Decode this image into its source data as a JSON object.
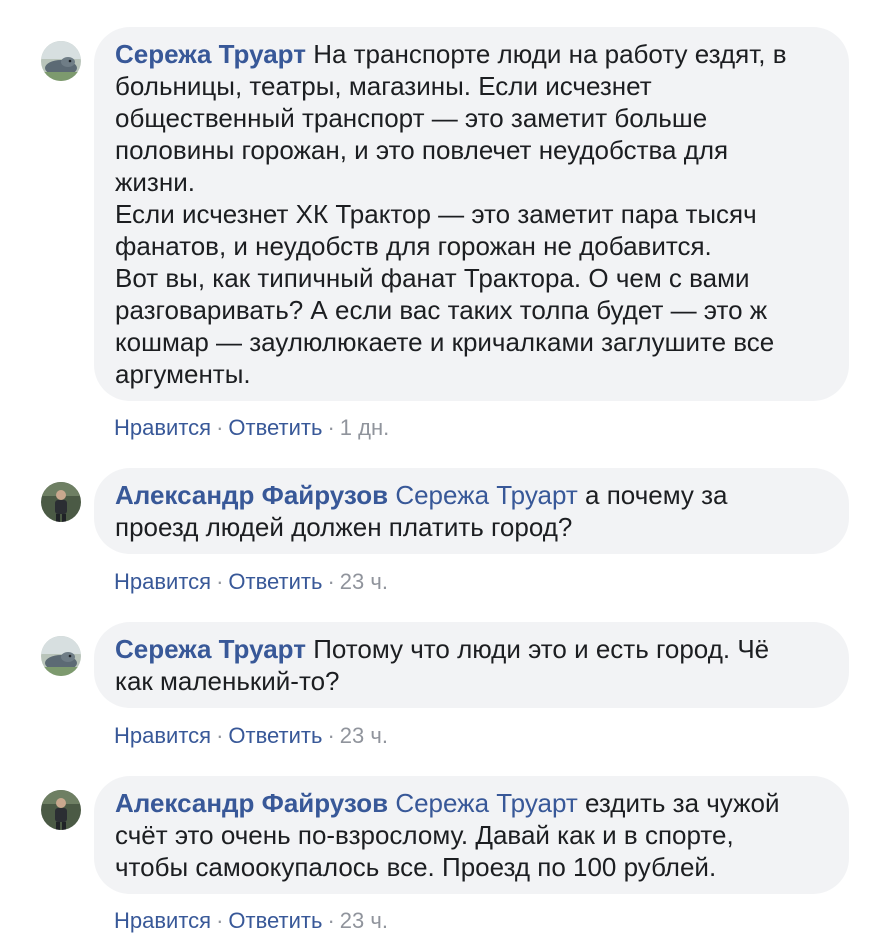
{
  "comments": [
    {
      "author": "Сережа Труарт",
      "mention": "",
      "lines": [
        "На транспорте люди на работу ездят, в",
        "больницы, театры, магазины. Если исчезнет",
        "общественный транспорт — это заметит больше",
        "половины горожан, и это повлечет неудобства для",
        "жизни.",
        "Если исчезнет ХК Трактор — это заметит пара тысяч",
        "фанатов, и неудобств для горожан не добавится.",
        "Вот вы, как типичный фанат Трактора. О чем с вами",
        "разговаривать? А если вас таких толпа будет — это ж",
        "кошмар — заулюлюкаете и кричалками заглушите все",
        "аргументы."
      ],
      "like_label": "Нравится",
      "reply_label": "Ответить",
      "separator": "·",
      "time": "1 дн.",
      "avatar_icon": "avatar-seal-icon"
    },
    {
      "author": "Александр Файрузов",
      "mention": "Сережа Труарт",
      "lines": [
        "а почему за",
        "проезд людей должен платить город?"
      ],
      "like_label": "Нравится",
      "reply_label": "Ответить",
      "separator": "·",
      "time": "23 ч.",
      "avatar_icon": "avatar-person-icon"
    },
    {
      "author": "Сережа Труарт",
      "mention": "",
      "lines": [
        "Потому что люди это и есть город. Чё",
        "как маленький-то?"
      ],
      "like_label": "Нравится",
      "reply_label": "Ответить",
      "separator": "·",
      "time": "23 ч.",
      "avatar_icon": "avatar-seal-icon"
    },
    {
      "author": "Александр Файрузов",
      "mention": "Сережа Труарт",
      "lines": [
        "ездить за чужой",
        "счёт это очень по-взрослому. Давай как и в спорте,",
        "чтобы самоокупалось все. Проезд по 100 рублей."
      ],
      "like_label": "Нравится",
      "reply_label": "Ответить",
      "separator": "·",
      "time": "23 ч.",
      "avatar_icon": "avatar-person-icon"
    }
  ],
  "colors": {
    "link": "#385898",
    "bubble": "#f2f3f5",
    "meta": "#90949c",
    "text": "#1c1e21"
  }
}
